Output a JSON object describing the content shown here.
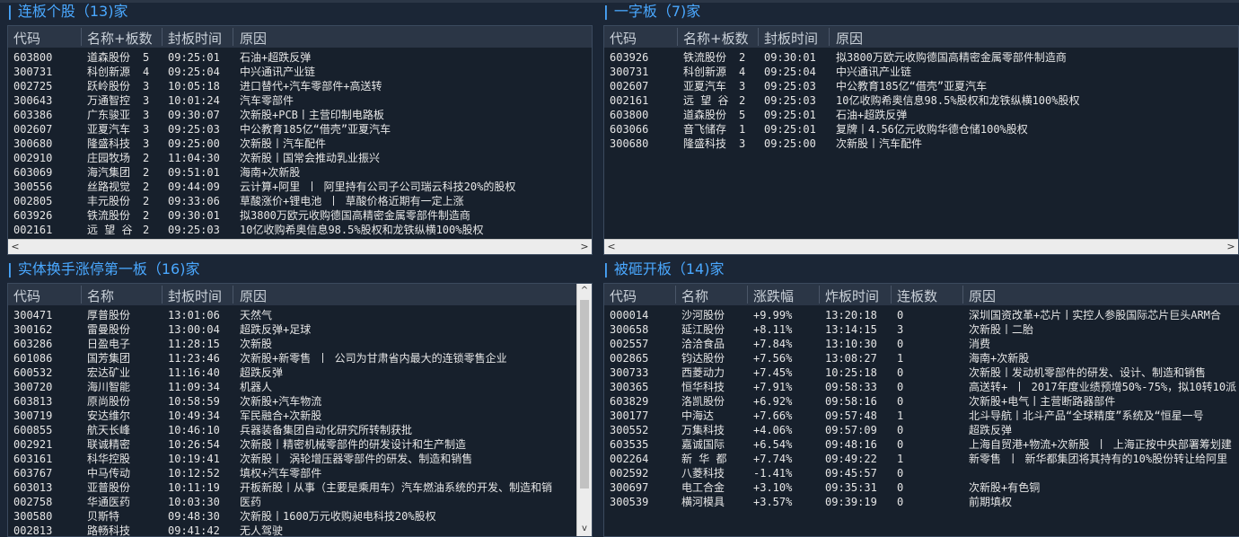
{
  "sections": {
    "lianban": {
      "title": "连板个股（13)家",
      "headers": [
        "代码",
        "名称+板数",
        "封板时间",
        "原因"
      ],
      "rows": [
        [
          "603800",
          "道森股份",
          "5",
          "09:25:01",
          "石油+超跌反弹"
        ],
        [
          "300731",
          "科创新源",
          "4",
          "09:25:04",
          "中兴通讯产业链"
        ],
        [
          "002725",
          "跃岭股份",
          "3",
          "10:05:18",
          "进口替代+汽车零部件+高送转"
        ],
        [
          "300643",
          "万通智控",
          "3",
          "10:01:24",
          "汽车零部件"
        ],
        [
          "603386",
          "广东骏亚",
          "3",
          "09:30:07",
          "次新股+PCB丨主营印制电路板"
        ],
        [
          "002607",
          "亚夏汽车",
          "3",
          "09:25:03",
          "中公教育185亿“借壳”亚夏汽车"
        ],
        [
          "300680",
          "隆盛科技",
          "3",
          "09:25:00",
          "次新股丨汽车配件"
        ],
        [
          "002910",
          "庄园牧场",
          "2",
          "11:04:30",
          "次新股丨国常会推动乳业振兴"
        ],
        [
          "603069",
          "海汽集团",
          "2",
          "09:51:01",
          "海南+次新股"
        ],
        [
          "300556",
          "丝路视觉",
          "2",
          "09:44:09",
          "云计算+阿里 丨 阿里持有公司子公司瑞云科技20%的股权"
        ],
        [
          "002805",
          "丰元股份",
          "2",
          "09:33:06",
          "草酸涨价+锂电池 丨 草酸价格近期有一定上涨"
        ],
        [
          "603926",
          "铁流股份",
          "2",
          "09:30:01",
          "拟3800万欧元收购德国高精密金属零部件制造商"
        ],
        [
          "002161",
          "远 望 谷",
          "2",
          "09:25:03",
          "10亿收购希奥信息98.5%股权和龙铁纵横100%股权"
        ]
      ]
    },
    "yizi": {
      "title": "一字板（7)家",
      "headers": [
        "代码",
        "名称+板数",
        "封板时间",
        "原因"
      ],
      "rows": [
        [
          "603926",
          "铁流股份",
          "2",
          "09:30:01",
          "拟3800万欧元收购德国高精密金属零部件制造商"
        ],
        [
          "300731",
          "科创新源",
          "4",
          "09:25:04",
          "中兴通讯产业链"
        ],
        [
          "002607",
          "亚夏汽车",
          "3",
          "09:25:03",
          "中公教育185亿“借壳”亚夏汽车"
        ],
        [
          "002161",
          "远 望 谷",
          "2",
          "09:25:03",
          "10亿收购希奥信息98.5%股权和龙铁纵横100%股权"
        ],
        [
          "603800",
          "道森股份",
          "5",
          "09:25:01",
          "石油+超跌反弹"
        ],
        [
          "603066",
          "音飞储存",
          "1",
          "09:25:01",
          "复牌丨4.56亿元收购华德仓储100%股权"
        ],
        [
          "300680",
          "隆盛科技",
          "3",
          "09:25:00",
          "次新股丨汽车配件"
        ]
      ]
    },
    "shiti": {
      "title": "实体换手涨停第一板（16)家",
      "headers": [
        "代码",
        "名称",
        "封板时间",
        "原因"
      ],
      "rows": [
        [
          "300471",
          "厚普股份",
          "13:01:06",
          "天然气"
        ],
        [
          "300162",
          "雷曼股份",
          "13:00:04",
          "超跌反弹+足球"
        ],
        [
          "603286",
          "日盈电子",
          "11:28:15",
          "次新股"
        ],
        [
          "601086",
          "国芳集团",
          "11:23:46",
          "次新股+新零售 丨 公司为甘肃省内最大的连锁零售企业"
        ],
        [
          "600532",
          "宏达矿业",
          "11:16:40",
          "超跌反弹"
        ],
        [
          "300720",
          "海川智能",
          "11:09:34",
          "机器人"
        ],
        [
          "603813",
          "原尚股份",
          "10:58:59",
          "次新股+汽车物流"
        ],
        [
          "300719",
          "安达维尔",
          "10:49:34",
          "军民融合+次新股"
        ],
        [
          "600855",
          "航天长峰",
          "10:46:10",
          "兵器装备集团自动化研究所转制获批"
        ],
        [
          "002921",
          "联诚精密",
          "10:26:54",
          "次新股丨精密机械零部件的研发设计和生产制造"
        ],
        [
          "603161",
          "科华控股",
          "10:19:41",
          "次新股丨 涡轮增压器零部件的研发、制造和销售"
        ],
        [
          "603767",
          "中马传动",
          "10:12:52",
          "填权+汽车零部件"
        ],
        [
          "603013",
          "亚普股份",
          "10:11:19",
          "开板新股丨从事（主要是乘用车）汽车燃油系统的开发、制造和销"
        ],
        [
          "002758",
          "华通医药",
          "10:03:30",
          "医药"
        ],
        [
          "300580",
          "贝斯特",
          "09:48:30",
          "次新股丨1600万元收购昶电科技20%股权"
        ],
        [
          "002813",
          "路畅科技",
          "09:41:42",
          "无人驾驶"
        ]
      ]
    },
    "beiza": {
      "title": "被砸开板（14)家",
      "headers": [
        "代码",
        "名称",
        "涨跌幅",
        "炸板时间",
        "连板数",
        "原因"
      ],
      "rows": [
        [
          "000014",
          "沙河股份",
          "+9.99%",
          "13:20:18",
          "0",
          "深圳国资改革+芯片丨实控人参股国际芯片巨头ARM合"
        ],
        [
          "300658",
          "延江股份",
          "+8.11%",
          "13:14:15",
          "3",
          "次新股丨二胎"
        ],
        [
          "002557",
          "洽洽食品",
          "+7.84%",
          "13:10:30",
          "0",
          "消费"
        ],
        [
          "002865",
          "钧达股份",
          "+7.56%",
          "13:08:27",
          "1",
          "海南+次新股"
        ],
        [
          "300733",
          "西菱动力",
          "+7.45%",
          "10:25:18",
          "0",
          "次新股丨发动机零部件的研发、设计、制造和销售"
        ],
        [
          "300365",
          "恒华科技",
          "+7.91%",
          "09:58:33",
          "0",
          "高送转+ 丨 2017年度业绩预增50%-75%，拟10转10派"
        ],
        [
          "603829",
          "洛凯股份",
          "+6.92%",
          "09:58:16",
          "0",
          "次新股+电气丨主营断路器部件"
        ],
        [
          "300177",
          "中海达",
          "+7.66%",
          "09:57:48",
          "1",
          "北斗导航丨北斗产品“全球精度”系统及“恒星一号"
        ],
        [
          "300552",
          "万集科技",
          "+4.06%",
          "09:57:09",
          "0",
          "超跌反弹"
        ],
        [
          "603535",
          "嘉诚国际",
          "+6.54%",
          "09:48:16",
          "0",
          "上海自贸港+物流+次新股 丨 上海正按中央部署筹划建"
        ],
        [
          "002264",
          "新 华 都",
          "+7.74%",
          "09:49:22",
          "1",
          "新零售 丨 新华都集团将其持有的10%股份转让给阿里"
        ],
        [
          "002592",
          "八菱科技",
          "-1.41%",
          "09:45:57",
          "0",
          ""
        ],
        [
          "300697",
          "电工合金",
          "+3.10%",
          "09:35:31",
          "0",
          "次新股+有色铜"
        ],
        [
          "300539",
          "横河模具",
          "+3.57%",
          "09:39:19",
          "0",
          "前期填权"
        ]
      ]
    }
  },
  "scroll": {
    "left": "<",
    "right": ">",
    "up": "^",
    "down": "v"
  }
}
